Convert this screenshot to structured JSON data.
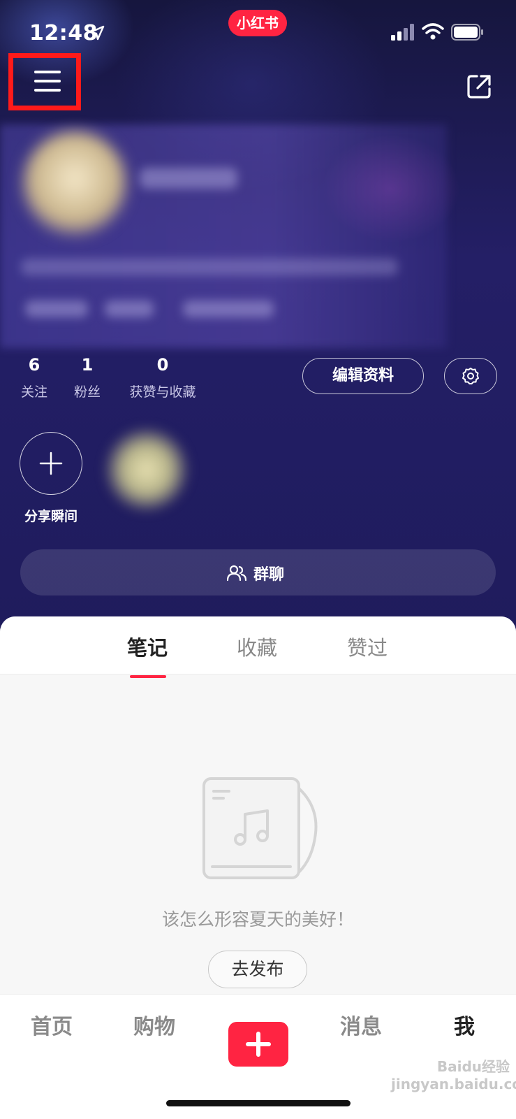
{
  "status_bar": {
    "time": "12:48"
  },
  "app_logo": "小红书",
  "stats": [
    {
      "value": "6",
      "label": "关注"
    },
    {
      "value": "1",
      "label": "粉丝"
    },
    {
      "value": "0",
      "label": "获赞与收藏"
    }
  ],
  "buttons": {
    "edit_profile": "编辑资料",
    "group_chat": "群聊"
  },
  "moments": {
    "share_label": "分享瞬间"
  },
  "tabs": [
    {
      "label": "笔记",
      "active": true
    },
    {
      "label": "收藏",
      "active": false
    },
    {
      "label": "赞过",
      "active": false
    }
  ],
  "empty_state": {
    "message": "该怎么形容夏天的美好！",
    "publish_button": "去发布"
  },
  "bottom_nav": [
    {
      "label": "首页",
      "active": false
    },
    {
      "label": "购物",
      "active": false
    },
    {
      "label": "消息",
      "active": false
    },
    {
      "label": "我",
      "active": true
    }
  ],
  "watermark": "Baidu经验 jingyan.baidu.com",
  "colors": {
    "brand": "#ff2442",
    "highlight_box": "#ff1a1a",
    "hero_bg": "#211d62"
  },
  "icons": [
    "location-arrow-icon",
    "signal-icon",
    "wifi-icon",
    "battery-icon",
    "menu-icon",
    "share-icon",
    "gear-icon",
    "plus-icon",
    "people-icon",
    "music-note-icon"
  ]
}
